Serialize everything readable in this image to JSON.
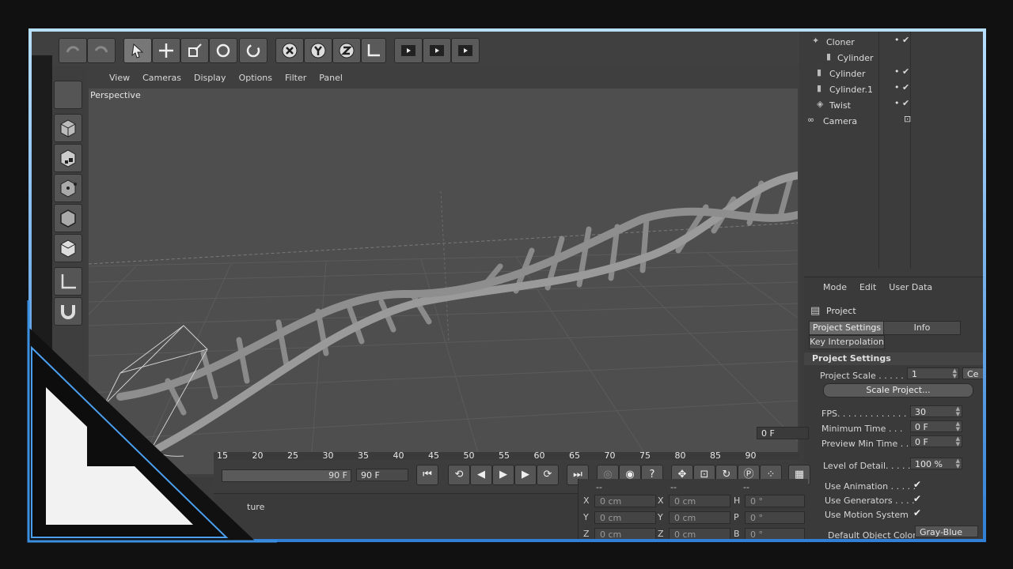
{
  "viewport": {
    "menu": [
      "View",
      "Cameras",
      "Display",
      "Options",
      "Filter",
      "Panel"
    ],
    "label": "Perspective"
  },
  "objects": [
    {
      "name": "Cloner",
      "icon": "cloner-icon"
    },
    {
      "name": "Cylinder",
      "icon": "cylinder-icon"
    },
    {
      "name": "Cylinder",
      "icon": "cylinder-icon"
    },
    {
      "name": "Cylinder.1",
      "icon": "cylinder-icon"
    },
    {
      "name": "Twist",
      "icon": "twist-icon"
    },
    {
      "name": "Camera",
      "icon": "camera-icon"
    }
  ],
  "attributes": {
    "menu": [
      "Mode",
      "Edit",
      "User Data"
    ],
    "object_label": "Project",
    "tabs": [
      "Project Settings",
      "Info"
    ],
    "tab2": "Key Interpolation",
    "section": "Project Settings",
    "project_scale_label": "Project Scale . . . . . . .",
    "project_scale_value": "1",
    "project_scale_unit": "Ce",
    "scale_button": "Scale Project...",
    "fps_label": "FPS. . . . . . . . . . . . . .",
    "fps_value": "30",
    "min_time_label": "Minimum Time . . .",
    "min_time_value": "0 F",
    "preview_min_label": "Preview Min Time . .",
    "preview_min_value": "0 F",
    "lod_label": "Level of Detail. . . . .",
    "lod_value": "100 %",
    "use_animation_label": "Use Animation . . . . .",
    "use_generators_label": "Use Generators . . . .",
    "use_motion_label": "Use Motion System",
    "default_color_label": "Default Object Color",
    "default_color_value": "Gray-Blue",
    "checkmark": "✔"
  },
  "timeline": {
    "ticks": [
      "15",
      "20",
      "25",
      "30",
      "35",
      "40",
      "45",
      "50",
      "55",
      "60",
      "65",
      "70",
      "75",
      "80",
      "85",
      "90"
    ],
    "current_frame": "0 F",
    "end_frame_slider": "90 F",
    "end_frame": "90 F"
  },
  "coords": {
    "headers": [
      "--",
      "--",
      "--"
    ],
    "rows": [
      {
        "a": "X",
        "av": "0 cm",
        "b": "X",
        "bv": "0 cm",
        "c": "H",
        "cv": "0 °"
      },
      {
        "a": "Y",
        "av": "0 cm",
        "b": "Y",
        "bv": "0 cm",
        "c": "P",
        "cv": "0 °"
      },
      {
        "a": "Z",
        "av": "0 cm",
        "b": "Z",
        "bv": "0 cm",
        "c": "B",
        "cv": "0 °"
      }
    ]
  },
  "material_label": "ture",
  "colors": {
    "frame_accent": "#4a9ff0",
    "panel_bg": "#3c3c3c",
    "viewport_bg": "#4e4e4e",
    "logo": "#f2f2f2"
  }
}
